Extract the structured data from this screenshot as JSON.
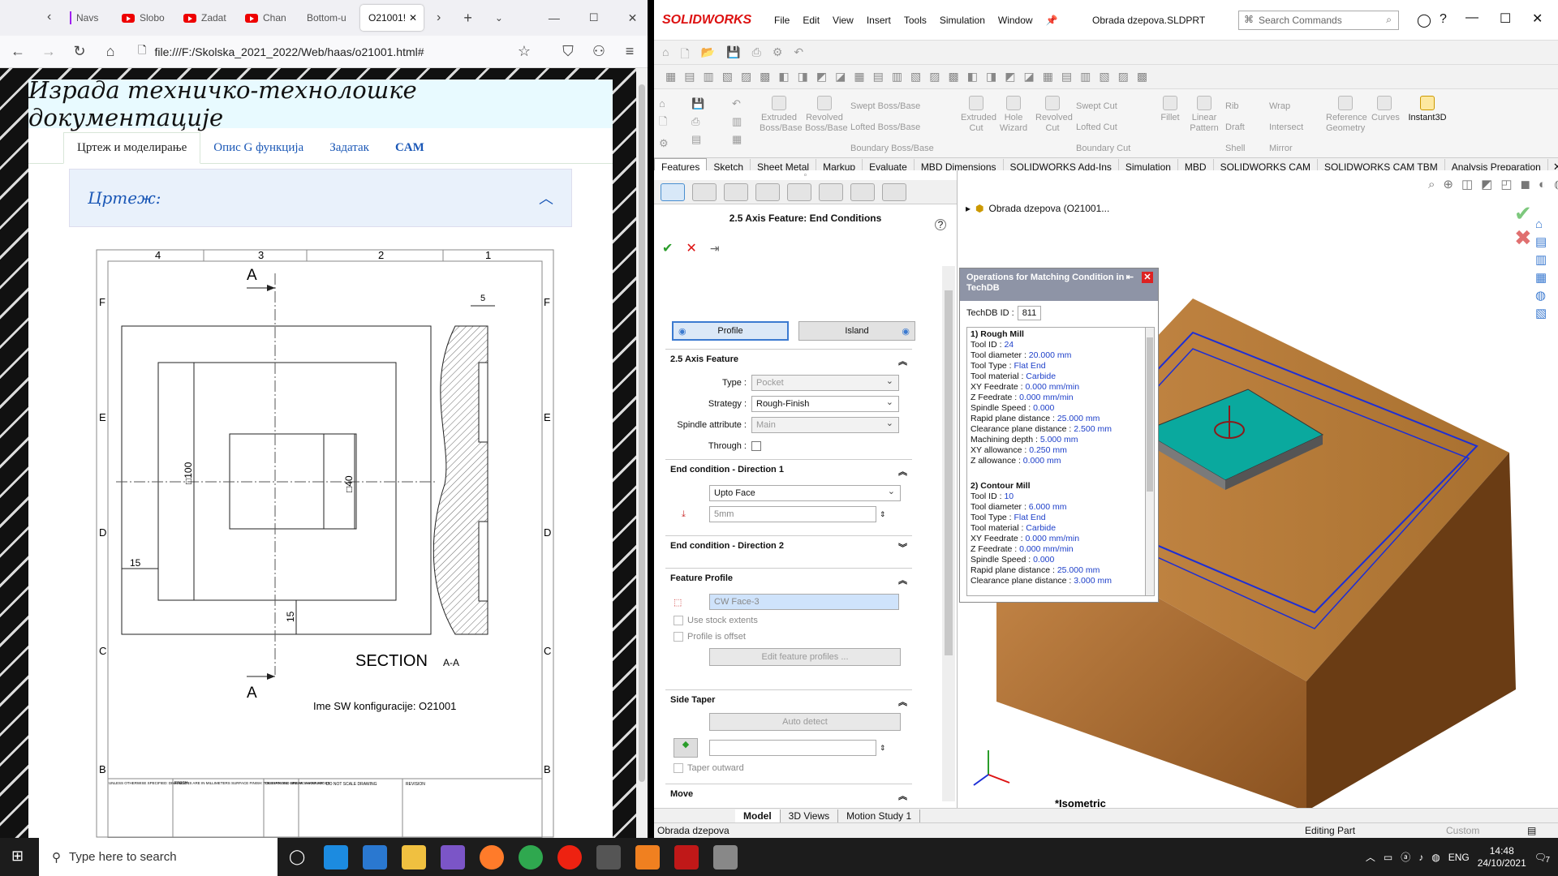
{
  "browser": {
    "tabs": [
      {
        "label": "Navs",
        "icon": "document-icon"
      },
      {
        "label": "Slobo",
        "icon": "youtube-icon"
      },
      {
        "label": "Zadat",
        "icon": "youtube-icon"
      },
      {
        "label": "Chan",
        "icon": "youtube-icon"
      },
      {
        "label": "Bottom-u",
        "icon": "none"
      },
      {
        "label": "O21001!",
        "icon": "none",
        "active": true
      }
    ],
    "url": "file:///F:/Skolska_2021_2022/Web/haas/o21001.html#",
    "page": {
      "header_title": "Израда техничко-технолошке документације",
      "tabs": [
        "Цртеж и моделирање",
        "Опис G функција",
        "Задатак",
        "CAM"
      ],
      "active_tab": 0,
      "accordion_title": "Цртеж:"
    },
    "drawing": {
      "col_labels": [
        "4",
        "3",
        "2",
        "1"
      ],
      "row_labels": [
        "F",
        "E",
        "D",
        "C",
        "B"
      ],
      "section_mark": "A",
      "section_title": "SECTION",
      "section_suffix": "A-A",
      "dims": {
        "outer": "□100",
        "inner": "□40",
        "left": "15",
        "bottom": "15",
        "top_right": "5"
      },
      "config_label": "Ime SW konfiguracije: O21001",
      "title_block": {
        "notes": "UNLESS OTHERWISE SPECIFIED: DIMENSIONS ARE IN MILLIMETERS SURFACE FINISH: TOLERANCES: LINEAR: ANGULAR:",
        "finish": "FINISH:",
        "deburr": "DEBURR AND BREAK SHARP EDGES",
        "noscale": "DO NOT SCALE DRAWING",
        "revision": "REVISION"
      }
    }
  },
  "sw": {
    "brand": "SOLIDWORKS",
    "menu": [
      "File",
      "Edit",
      "View",
      "Insert",
      "Tools",
      "Simulation",
      "Window"
    ],
    "filename": "Obrada dzepova.SLDPRT",
    "search_placeholder": "Search Commands",
    "commands": {
      "extruded_boss": "Extruded Boss/Base",
      "revolved_boss": "Revolved Boss/Base",
      "swept_boss": "Swept Boss/Base",
      "lofted_boss": "Lofted Boss/Base",
      "boundary_boss": "Boundary Boss/Base",
      "extruded_cut": "Extruded Cut",
      "hole_wizard": "Hole Wizard",
      "revolved_cut": "Revolved Cut",
      "swept_cut": "Swept Cut",
      "lofted_cut": "Lofted Cut",
      "boundary_cut": "Boundary Cut",
      "fillet": "Fillet",
      "linear_pattern": "Linear Pattern",
      "rib": "Rib",
      "draft": "Draft",
      "shell": "Shell",
      "wrap": "Wrap",
      "intersect": "Intersect",
      "mirror": "Mirror",
      "ref_geometry": "Reference Geometry",
      "curves": "Curves",
      "instant3d": "Instant3D"
    },
    "cmd_tabs": [
      "Features",
      "Sketch",
      "Sheet Metal",
      "Markup",
      "Evaluate",
      "MBD Dimensions",
      "SOLIDWORKS Add-Ins",
      "Simulation",
      "MBD",
      "SOLIDWORKS CAM",
      "SOLIDWORKS CAM TBM",
      "Analysis Preparation"
    ],
    "pm": {
      "title": "2.5 Axis Feature: End Conditions",
      "profile_btn": "Profile",
      "island_btn": "Island",
      "sec_feature": "2.5 Axis Feature",
      "type_label": "Type :",
      "type_value": "Pocket",
      "strategy_label": "Strategy :",
      "strategy_value": "Rough-Finish",
      "spindle_label": "Spindle attribute :",
      "spindle_value": "Main",
      "through_label": "Through :",
      "sec_end1": "End condition - Direction 1",
      "end1_value": "Upto Face",
      "depth_value": "5mm",
      "sec_end2": "End condition - Direction 2",
      "sec_profile": "Feature Profile",
      "profile_face": "CW Face-3",
      "use_stock": "Use stock extents",
      "profile_offset": "Profile is offset",
      "edit_profiles": "Edit feature profiles ...",
      "sec_taper": "Side Taper",
      "auto_detect": "Auto detect",
      "taper_outward": "Taper outward",
      "sec_move": "Move"
    },
    "tree_root": "Obrada dzepova (O21001...",
    "techdb": {
      "title": "Operations for Matching Condition in TechDB",
      "id_label": "TechDB ID :",
      "id_value": "811",
      "ops": [
        {
          "name": "1) Rough Mill",
          "fields": [
            [
              "Tool ID :",
              "24"
            ],
            [
              "Tool diameter :",
              "20.000 mm"
            ],
            [
              "Tool Type :",
              "Flat End"
            ],
            [
              "Tool material :",
              "Carbide"
            ],
            [
              "XY Feedrate :",
              "0.000 mm/min"
            ],
            [
              "Z Feedrate :",
              "0.000 mm/min"
            ],
            [
              "Spindle Speed :",
              "0.000"
            ],
            [
              "Rapid plane distance :",
              "25.000 mm"
            ],
            [
              "Clearance plane distance :",
              "2.500 mm"
            ],
            [
              "Machining depth :",
              "5.000 mm"
            ],
            [
              "XY allowance :",
              "0.250 mm"
            ],
            [
              "Z allowance :",
              "0.000 mm"
            ]
          ]
        },
        {
          "name": "2) Contour Mill",
          "fields": [
            [
              "Tool ID :",
              "10"
            ],
            [
              "Tool diameter :",
              "6.000 mm"
            ],
            [
              "Tool Type :",
              "Flat End"
            ],
            [
              "Tool material :",
              "Carbide"
            ],
            [
              "XY Feedrate :",
              "0.000 mm/min"
            ],
            [
              "Z Feedrate :",
              "0.000 mm/min"
            ],
            [
              "Spindle Speed :",
              "0.000"
            ],
            [
              "Rapid plane distance :",
              "25.000 mm"
            ],
            [
              "Clearance plane distance :",
              "3.000 mm"
            ]
          ]
        }
      ]
    },
    "view_label": "*Isometric",
    "bottom_tabs": [
      "Model",
      "3D Views",
      "Motion Study 1"
    ],
    "status_left": "Obrada dzepova",
    "status_mid": "Editing Part",
    "status_right": "Custom"
  },
  "taskbar": {
    "search_placeholder": "Type here to search",
    "lang": "ENG",
    "time": "14:48",
    "date": "24/10/2021",
    "notif_count": "7"
  }
}
